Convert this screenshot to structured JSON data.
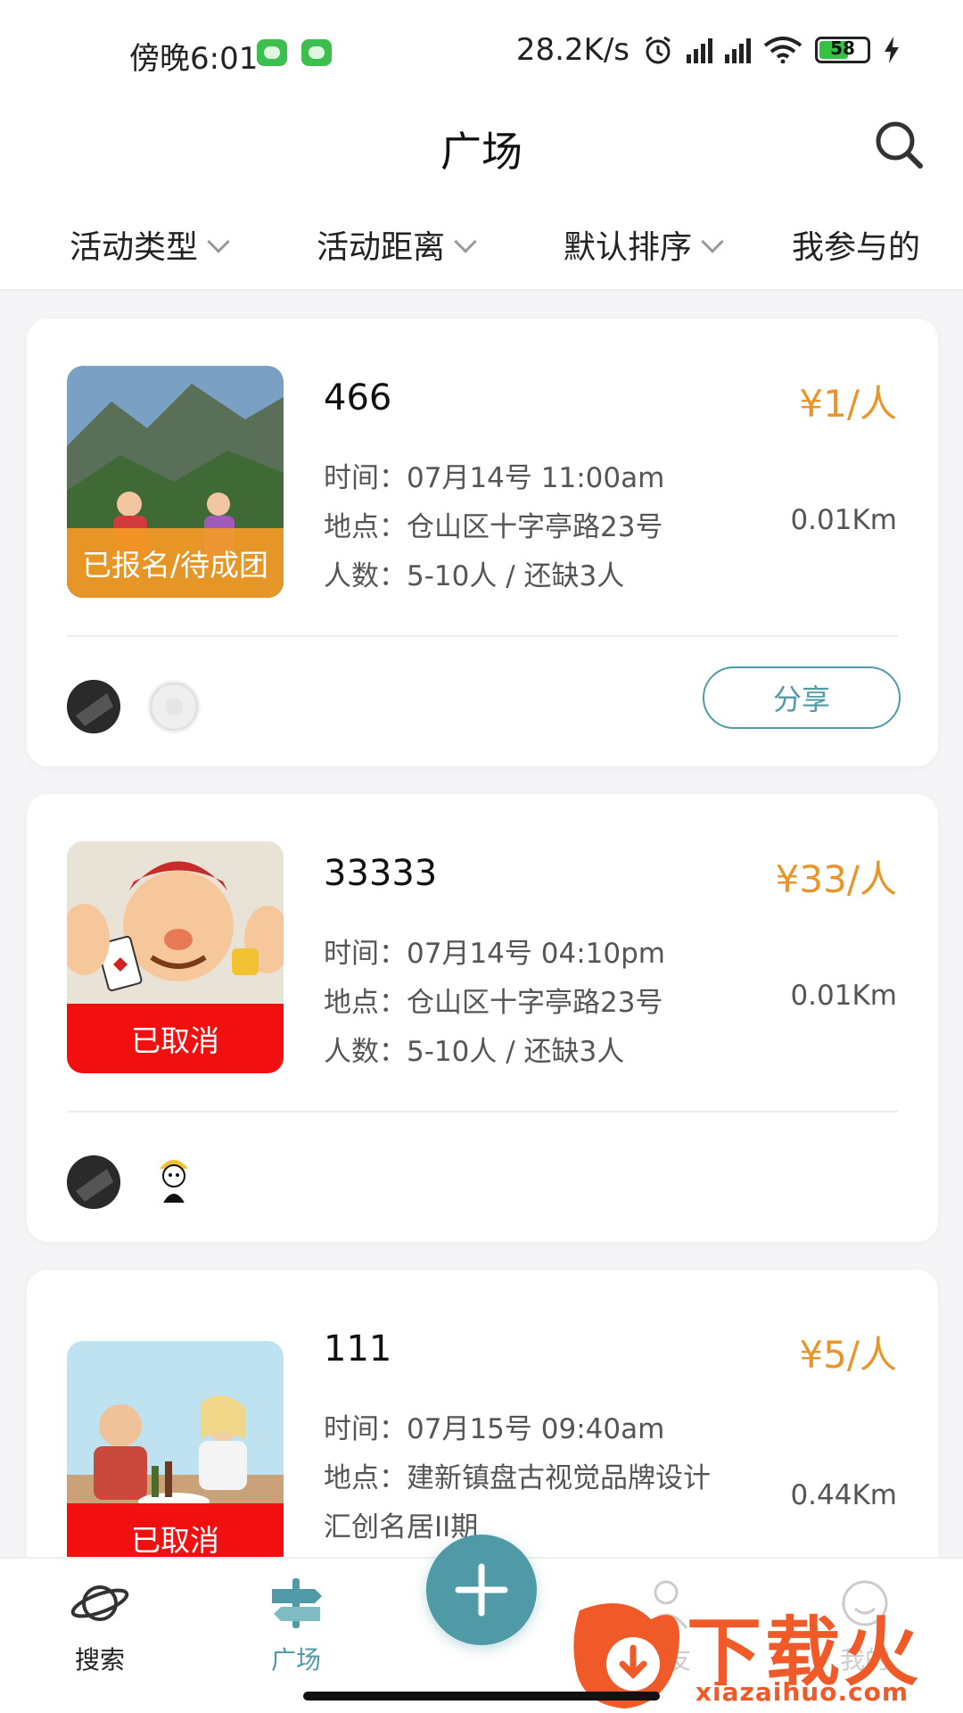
{
  "status_bar": {
    "time": "傍晚6:01",
    "net_speed": "28.2K/s",
    "battery": "58",
    "icons": [
      "app-icon",
      "app-icon",
      "alarm-icon",
      "hd-signal-icon",
      "hd-signal-icon",
      "wifi-icon",
      "battery-icon",
      "charging-icon"
    ]
  },
  "header": {
    "title": "广场",
    "search_icon": "search-icon"
  },
  "filters": [
    {
      "label": "活动类型"
    },
    {
      "label": "活动距离"
    },
    {
      "label": "默认排序"
    },
    {
      "label": "我参与的"
    }
  ],
  "cards": [
    {
      "name": "466",
      "price": "¥1/人",
      "time": "时间：07月14号 11:00am",
      "place": "地点：仓山区十字亭路23号",
      "people": "人数：5-10人 / 还缺3人",
      "distance": "0.01Km",
      "status": "已报名/待成团",
      "status_color": "#f39a26",
      "share": "分享"
    },
    {
      "name": "33333",
      "price": "¥33/人",
      "time": "时间：07月14号 04:10pm",
      "place": "地点：仓山区十字亭路23号",
      "people": "人数：5-10人 / 还缺3人",
      "distance": "0.01Km",
      "status": "已取消",
      "status_color": "#f20f0f"
    },
    {
      "name": "111",
      "price": "¥5/人",
      "time": "时间：07月15号 09:40am",
      "place": "地点：建新镇盘古视觉品牌设计",
      "place2": "汇创名居II期",
      "distance": "0.44Km",
      "status": "已取消",
      "status_color": "#f20f0f"
    }
  ],
  "bottom_nav": [
    {
      "label": "搜索",
      "icon": "planet-icon"
    },
    {
      "label": "广场",
      "icon": "signpost-icon",
      "active": true
    },
    {
      "label": "",
      "icon": "plus-icon"
    },
    {
      "label": "好友",
      "icon": "person-icon"
    },
    {
      "label": "我的",
      "icon": "smile-icon"
    }
  ],
  "watermark": {
    "text": "下载火",
    "url": "xiazaihuo.com"
  },
  "colors": {
    "accent": "#4f9aa6",
    "price": "#e8962a",
    "pending": "#f39a26",
    "cancelled": "#f20f0f",
    "watermark": "#f05a28"
  }
}
